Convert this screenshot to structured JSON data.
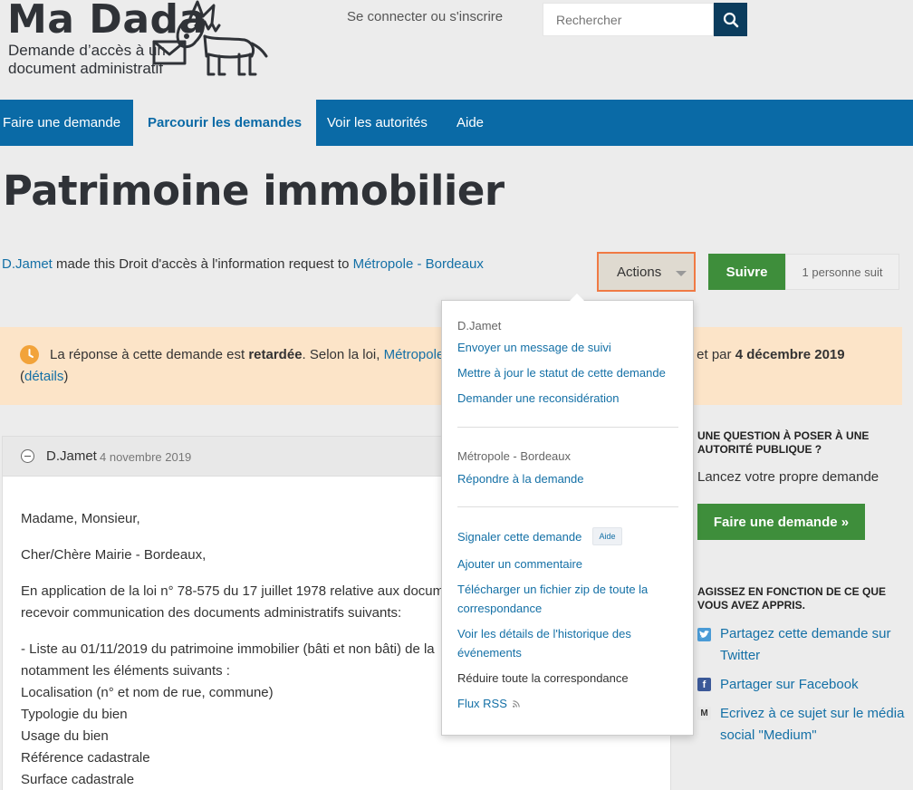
{
  "header": {
    "logo_title": "Ma Dada",
    "logo_subtitle": "Demande d’accès à un document administratif",
    "signin": "Se connecter ou s'inscrire",
    "search_placeholder": "Rechercher"
  },
  "nav": {
    "items": [
      "Faire une demande",
      "Parcourir les demandes",
      "Voir les autorités",
      "Aide"
    ],
    "active": "Parcourir les demandes"
  },
  "request": {
    "title": "Patrimoine immobilier",
    "author": "D.Jamet",
    "byline_mid": " made this Droit d'accès à l'information request to ",
    "authority": "Métropole - Bordeaux",
    "actions_label": "Actions",
    "follow_label": "Suivre",
    "followers": "1 personne suit"
  },
  "notice": {
    "text1": "La réponse à cette demande est ",
    "status": "retardée",
    "text2": ". Selon la loi, ",
    "authority_link": "Métropole",
    "tail_bold": "t",
    "tail_text": " et par ",
    "deadline": "4 décembre 2019",
    "details_open": "(",
    "details_link": "détails",
    "details_close": ")"
  },
  "correspondence": {
    "author": "D.Jamet",
    "date": "4 novembre 2019",
    "lines": [
      "Madame, Monsieur,",
      "Cher/Chère Mairie - Bordeaux,",
      "En application de la loi n° 78-575 du 17 juillet 1978 relative aux docume",
      "recevoir communication des documents administratifs suivants:",
      "- Liste au 01/11/2019 du patrimoine immobilier (bâti et non bâti) de la",
      "notamment les éléments suivants :",
      "Localisation (n° et nom de rue, commune)",
      "Typologie du bien",
      "Usage du bien",
      "Référence cadastrale",
      "Surface cadastrale"
    ]
  },
  "actions_menu": {
    "user_heading": "D.Jamet",
    "user_items": [
      "Envoyer un message de suivi",
      "Mettre à jour le statut de cette demande",
      "Demander une reconsidération"
    ],
    "authority_heading": "Métropole - Bordeaux",
    "authority_items": [
      "Répondre à la demande"
    ],
    "other_items": [
      "Signaler cette demande",
      "Ajouter un commentaire",
      "Télécharger un fichier zip de toute la correspondance",
      "Voir les détails de l'historique des événements",
      "Réduire toute la correspondance",
      "Flux RSS"
    ],
    "help_badge": "Aide"
  },
  "sidebar": {
    "question_heading": "Une question à poser à une autorité publique ?",
    "question_text": "Lancez votre propre demande",
    "make_request": "Faire une demande »",
    "act_heading": "Agissez en fonction de ce que vous avez appris.",
    "share": [
      {
        "label": "Partagez cette demande sur Twitter",
        "icon": "twitter-icon"
      },
      {
        "label": "Partager sur Facebook",
        "icon": "facebook-icon"
      },
      {
        "label": "Ecrivez à ce sujet sur le média social \"Medium\"",
        "icon": "medium-icon"
      }
    ]
  },
  "colors": {
    "nav": "#0a6aa6",
    "link": "#1470a6",
    "green": "#3e8e3b",
    "notice": "#fce4c8",
    "search_button": "#0b3c5d",
    "actions_border": "#f07a44"
  }
}
